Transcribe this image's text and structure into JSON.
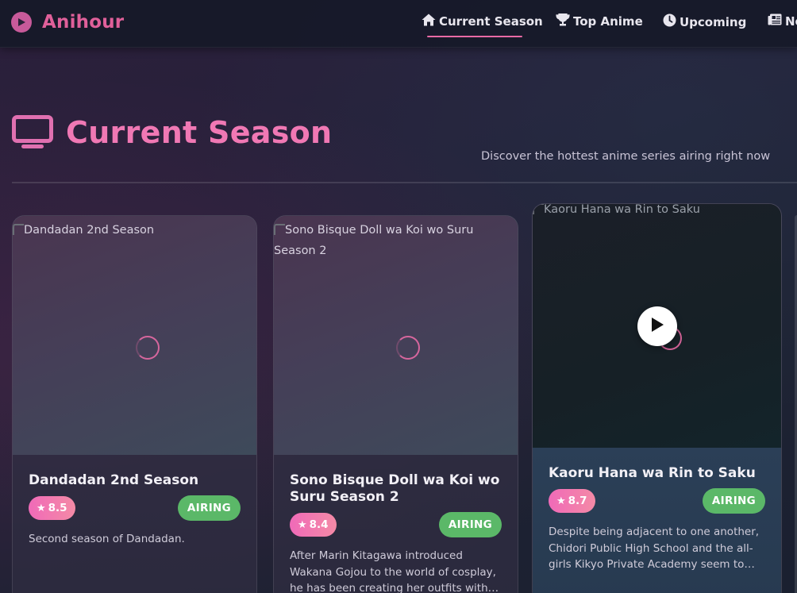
{
  "brand": {
    "name": "Anihour",
    "icon": "play-circle-icon"
  },
  "nav": [
    {
      "label": "Current Season",
      "icon": "home-icon",
      "active": true
    },
    {
      "label": "Top Anime",
      "icon": "trophy-icon"
    },
    {
      "label": "Upcoming",
      "icon": "clock-icon"
    },
    {
      "label": "Ne",
      "icon": "newspaper-icon"
    }
  ],
  "page": {
    "title": "Current Season",
    "icon": "tv-icon",
    "subtitle": "Discover the hottest anime series airing right now"
  },
  "cards": [
    {
      "image_alt": "Dandadan 2nd Season",
      "title": "Dandadan 2nd Season",
      "rating": "8.5",
      "status": "AIRING",
      "synopsis": "Second season of Dandadan."
    },
    {
      "image_alt": "Sono Bisque Doll wa Koi wo Suru Season 2",
      "title": "Sono Bisque Doll wa Koi wo Suru Season 2",
      "rating": "8.4",
      "status": "AIRING",
      "synopsis": "After Marin Kitagawa introduced Wakana Gojou to the world of cosplay, he has been creating her outfits with ease. Even..."
    },
    {
      "image_alt": "Kaoru Hana wa Rin to Saku",
      "title": "Kaoru Hana wa Rin to Saku",
      "rating": "8.7",
      "status": "AIRING",
      "synopsis": "Despite being adjacent to one another, Chidori Public High School and the all-girls Kikyo Private Academy seem to exi..."
    }
  ],
  "symbols": {
    "star": "★"
  },
  "colors": {
    "accent": "#e86aa5",
    "status_green": "#5bb868",
    "brand": "#e0609a"
  }
}
